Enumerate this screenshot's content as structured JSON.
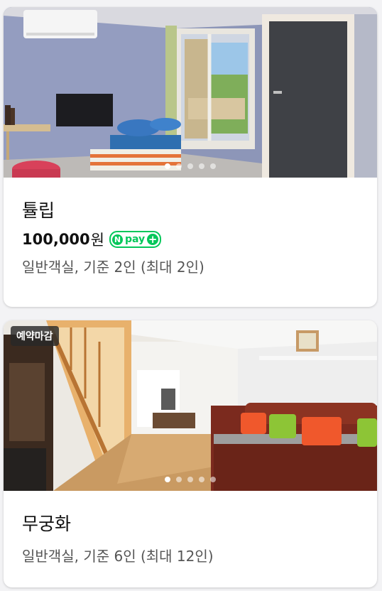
{
  "rooms": [
    {
      "name": "튤립",
      "price": "100,000",
      "price_unit": "원",
      "npay": {
        "n": "N",
        "text": "pay",
        "plus": "+"
      },
      "description": "일반객실, 기준 2인 (최대 2인)",
      "photo_icon": "room-photo",
      "carousel_dots": 5,
      "active_dot": 1
    },
    {
      "name": "무궁화",
      "badge": "예약마감",
      "description": "일반객실, 기준 6인 (최대 12인)",
      "photo_icon": "room-photo",
      "carousel_dots": 5,
      "active_dot": 1
    }
  ],
  "colors": {
    "npay_green": "#03c75a",
    "text_primary": "#111111",
    "text_secondary": "#555555"
  }
}
